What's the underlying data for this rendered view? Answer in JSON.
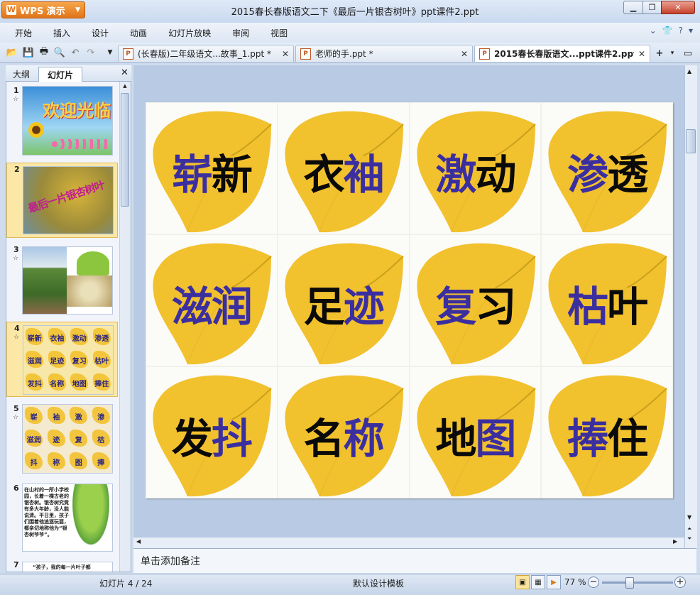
{
  "app": {
    "menu_button": "WPS 演示",
    "window_title": "2015春长春版语文二下《最后一片银杏树叶》ppt课件2.ppt"
  },
  "menu": [
    "开始",
    "插入",
    "设计",
    "动画",
    "幻灯片放映",
    "审阅",
    "视图"
  ],
  "doc_tabs": [
    {
      "label": "(长春版)二年级语文...故事_1.ppt *",
      "active": false
    },
    {
      "label": "老师的手.ppt *",
      "active": false
    },
    {
      "label": "2015春长春版语文...ppt课件2.ppt",
      "active": true
    }
  ],
  "panel": {
    "outline_tab": "大纲",
    "slides_tab": "幻灯片"
  },
  "thumbnails": [
    {
      "num": "1",
      "star": "☆",
      "caption": "欢迎光临",
      "kind": "welcome"
    },
    {
      "num": "2",
      "star": "",
      "caption": "最后一片银杏树叶",
      "kind": "tree"
    },
    {
      "num": "3",
      "star": "☆",
      "caption": "",
      "kind": "photos"
    },
    {
      "num": "4",
      "star": "☆",
      "caption": "",
      "kind": "words",
      "words": [
        "崭新",
        "衣袖",
        "激动",
        "渗透",
        "滋润",
        "足迹",
        "复习",
        "枯叶",
        "发抖",
        "名称",
        "地图",
        "捧住"
      ]
    },
    {
      "num": "5",
      "star": "☆",
      "caption": "",
      "kind": "chars",
      "words": [
        "崭",
        "袖",
        "激",
        "渗",
        "滋润",
        "迹",
        "复",
        "枯",
        "抖",
        "称",
        "图",
        "捧"
      ]
    },
    {
      "num": "6",
      "star": "",
      "caption": "在山村的一所小学校园，长着一棵古老的银杏树。银杏树究竟有多大年龄，没人能说清。平日里，孩子们围着他追逐玩耍，都亲切地称他为“银杏树爷爷”。",
      "kind": "text"
    },
    {
      "num": "7",
      "star": "",
      "caption": "“孩子，我的每一片叶子都",
      "kind": "text"
    }
  ],
  "slide_words": [
    {
      "text": "崭新",
      "chars": [
        {
          "c": "崭",
          "color": "blue"
        },
        {
          "c": "新",
          "color": "black"
        }
      ]
    },
    {
      "text": "衣袖",
      "chars": [
        {
          "c": "衣",
          "color": "black"
        },
        {
          "c": "袖",
          "color": "blue"
        }
      ]
    },
    {
      "text": "激动",
      "chars": [
        {
          "c": "激",
          "color": "blue"
        },
        {
          "c": "动",
          "color": "black"
        }
      ]
    },
    {
      "text": "渗透",
      "chars": [
        {
          "c": "渗",
          "color": "blue"
        },
        {
          "c": "透",
          "color": "black"
        }
      ]
    },
    {
      "text": "滋润",
      "chars": [
        {
          "c": "滋",
          "color": "blue"
        },
        {
          "c": "润",
          "color": "blue"
        }
      ]
    },
    {
      "text": "足迹",
      "chars": [
        {
          "c": "足",
          "color": "black"
        },
        {
          "c": "迹",
          "color": "blue"
        }
      ]
    },
    {
      "text": "复习",
      "chars": [
        {
          "c": "复",
          "color": "blue"
        },
        {
          "c": "习",
          "color": "black"
        }
      ]
    },
    {
      "text": "枯叶",
      "chars": [
        {
          "c": "枯",
          "color": "blue"
        },
        {
          "c": "叶",
          "color": "black"
        }
      ]
    },
    {
      "text": "发抖",
      "chars": [
        {
          "c": "发",
          "color": "black"
        },
        {
          "c": "抖",
          "color": "blue"
        }
      ]
    },
    {
      "text": "名称",
      "chars": [
        {
          "c": "名",
          "color": "black"
        },
        {
          "c": "称",
          "color": "blue"
        }
      ]
    },
    {
      "text": "地图",
      "chars": [
        {
          "c": "地",
          "color": "black"
        },
        {
          "c": "图",
          "color": "blue"
        }
      ]
    },
    {
      "text": "捧住",
      "chars": [
        {
          "c": "捧",
          "color": "blue"
        },
        {
          "c": "住",
          "color": "black"
        }
      ]
    }
  ],
  "notes_placeholder": "单击添加备注",
  "status": {
    "slide_indicator": "幻灯片 4 / 24",
    "template": "默认设计模板",
    "zoom": "77 %",
    "zoom_fraction": 0.38
  },
  "colors": {
    "blue_char": "#3b2fa0",
    "black_char": "#0a0a0a",
    "leaf": "#f2c12e"
  }
}
